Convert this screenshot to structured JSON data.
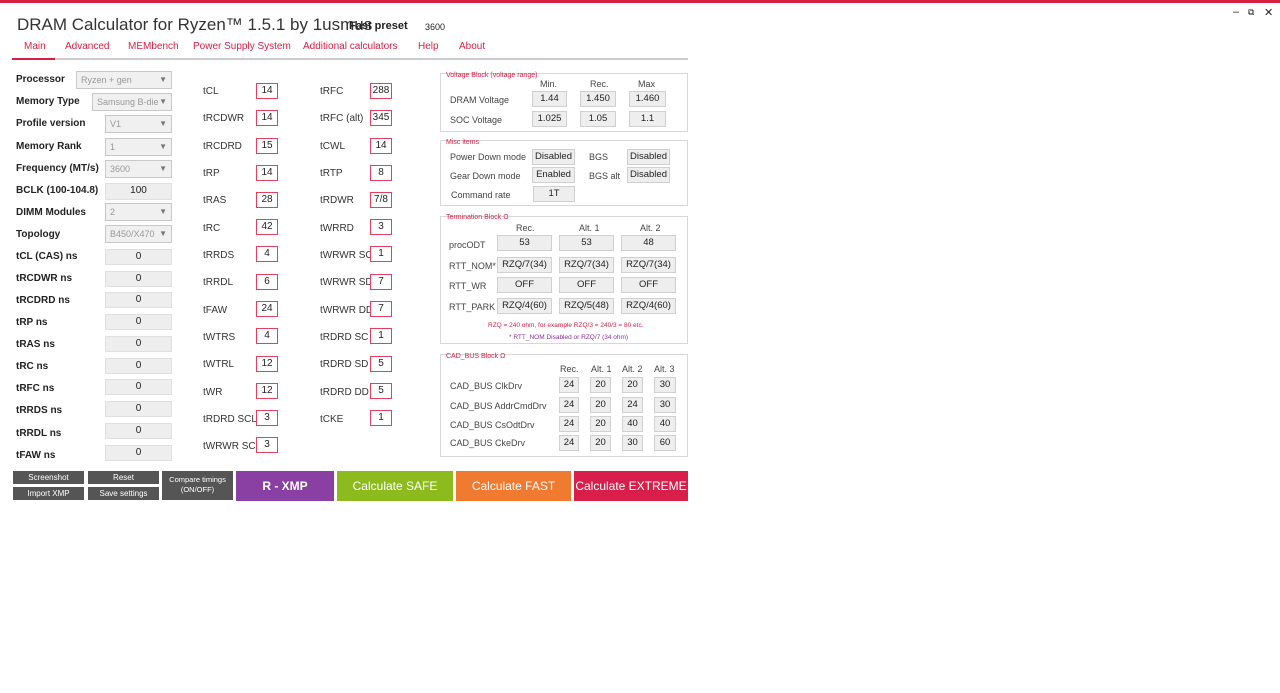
{
  "app": {
    "title": "DRAM Calculator for Ryzen™ 1.5.1 by 1usmus",
    "preset_label": "Fast preset",
    "preset_value": "3600"
  },
  "window": {
    "minimize": "–",
    "restore": "⧉",
    "close": "✕"
  },
  "tabs": [
    "Main",
    "Advanced",
    "MEMbench",
    "Power Supply System",
    "Additional calculators",
    "Help",
    "About"
  ],
  "settings": [
    {
      "label": "Processor",
      "value": "Ryzen + gen"
    },
    {
      "label": "Memory Type",
      "value": "Samsung B-die"
    },
    {
      "label": "Profile version",
      "value": "V1"
    },
    {
      "label": "Memory Rank",
      "value": "1"
    },
    {
      "label": "Frequency (MT/s)",
      "value": "3600"
    },
    {
      "label": "BCLK (100-104.8)",
      "value": "100"
    },
    {
      "label": "DIMM Modules",
      "value": "2"
    },
    {
      "label": "Topology",
      "value": "B450/X470"
    }
  ],
  "ns": [
    {
      "label": "tCL (CAS) ns",
      "value": "0"
    },
    {
      "label": "tRCDWR ns",
      "value": "0"
    },
    {
      "label": "tRCDRD ns",
      "value": "0"
    },
    {
      "label": "tRP ns",
      "value": "0"
    },
    {
      "label": "tRAS ns",
      "value": "0"
    },
    {
      "label": "tRC ns",
      "value": "0"
    },
    {
      "label": "tRFC ns",
      "value": "0"
    },
    {
      "label": "tRRDS ns",
      "value": "0"
    },
    {
      "label": "tRRDL ns",
      "value": "0"
    },
    {
      "label": "tFAW ns",
      "value": "0"
    }
  ],
  "timings_col1": [
    {
      "label": "tCL",
      "value": "14"
    },
    {
      "label": "tRCDWR",
      "value": "14"
    },
    {
      "label": "tRCDRD",
      "value": "15"
    },
    {
      "label": "tRP",
      "value": "14"
    },
    {
      "label": "tRAS",
      "value": "28"
    },
    {
      "label": "tRC",
      "value": "42"
    },
    {
      "label": "tRRDS",
      "value": "4"
    },
    {
      "label": "tRRDL",
      "value": "6"
    },
    {
      "label": "tFAW",
      "value": "24"
    },
    {
      "label": "tWTRS",
      "value": "4"
    },
    {
      "label": "tWTRL",
      "value": "12"
    },
    {
      "label": "tWR",
      "value": "12"
    },
    {
      "label": "tRDRD SCL",
      "value": "3"
    },
    {
      "label": "tWRWR SCL",
      "value": "3"
    }
  ],
  "timings_col2": [
    {
      "label": "tRFC",
      "value": "288"
    },
    {
      "label": "tRFC (alt)",
      "value": "345"
    },
    {
      "label": "tCWL",
      "value": "14"
    },
    {
      "label": "tRTP",
      "value": "8"
    },
    {
      "label": "tRDWR",
      "value": "7/8"
    },
    {
      "label": "tWRRD",
      "value": "3"
    },
    {
      "label": "tWRWR SC",
      "value": "1"
    },
    {
      "label": "tWRWR SD",
      "value": "7"
    },
    {
      "label": "tWRWR DD",
      "value": "7"
    },
    {
      "label": "tRDRD SC",
      "value": "1"
    },
    {
      "label": "tRDRD SD",
      "value": "5"
    },
    {
      "label": "tRDRD DD",
      "value": "5"
    },
    {
      "label": "tCKE",
      "value": "1"
    }
  ],
  "voltage": {
    "title": "Voltage Block (voltage range)",
    "headers": [
      "Min.",
      "Rec.",
      "Max"
    ],
    "rows": [
      {
        "label": "DRAM Voltage",
        "values": [
          "1.44",
          "1.450",
          "1.460"
        ]
      },
      {
        "label": "SOC Voltage",
        "values": [
          "1.025",
          "1.05",
          "1.1"
        ]
      }
    ]
  },
  "misc": {
    "title": "Misc items",
    "pdm_label": "Power Down mode",
    "pdm_value": "Disabled",
    "bgs_label": "BGS",
    "bgs_value": "Disabled",
    "gdm_label": "Gear Down mode",
    "gdm_value": "Enabled",
    "bgsalt_label": "BGS alt",
    "bgsalt_value": "Disabled",
    "cr_label": "Command rate",
    "cr_value": "1T"
  },
  "termination": {
    "title": "Termination Block Ω",
    "headers": [
      "Rec.",
      "Alt. 1",
      "Alt. 2"
    ],
    "rows": [
      {
        "label": "procODT",
        "values": [
          "53",
          "53",
          "48"
        ]
      },
      {
        "label": "RTT_NOM*",
        "values": [
          "RZQ/7(34)",
          "RZQ/7(34)",
          "RZQ/7(34)"
        ]
      },
      {
        "label": "RTT_WR",
        "values": [
          "OFF",
          "OFF",
          "OFF"
        ]
      },
      {
        "label": "RTT_PARK",
        "values": [
          "RZQ/4(60)",
          "RZQ/5(48)",
          "RZQ/4(60)"
        ]
      }
    ],
    "note1": "RZQ = 240 ohm, for example RZQ/3 = 240/3 = 80 etc.",
    "note2": "* RTT_NOM Disabled or RZQ/7 (34 ohm)"
  },
  "cadbus": {
    "title": "CAD_BUS Block Ω",
    "headers": [
      "Rec.",
      "Alt. 1",
      "Alt. 2",
      "Alt. 3"
    ],
    "rows": [
      {
        "label": "CAD_BUS ClkDrv",
        "values": [
          "24",
          "20",
          "20",
          "30"
        ]
      },
      {
        "label": "CAD_BUS AddrCmdDrv",
        "values": [
          "24",
          "20",
          "24",
          "30"
        ]
      },
      {
        "label": "CAD_BUS CsOdtDrv",
        "values": [
          "24",
          "20",
          "40",
          "40"
        ]
      },
      {
        "label": "CAD_BUS CkeDrv",
        "values": [
          "24",
          "20",
          "30",
          "60"
        ]
      }
    ]
  },
  "buttons": {
    "screenshot": "Screenshot",
    "reset": "Reset",
    "import_xmp": "Import XMP",
    "save_settings": "Save settings",
    "compare": "Compare timings (ON/OFF)",
    "rxmp": "R - XMP",
    "safe": "Calculate SAFE",
    "fast": "Calculate FAST",
    "extreme": "Calculate EXTREME"
  },
  "colors": {
    "accent": "#d81e42",
    "rxmp": "#8a3fa3",
    "safe": "#8dbb1e",
    "fast": "#f07a30",
    "extreme": "#d81e4a"
  }
}
